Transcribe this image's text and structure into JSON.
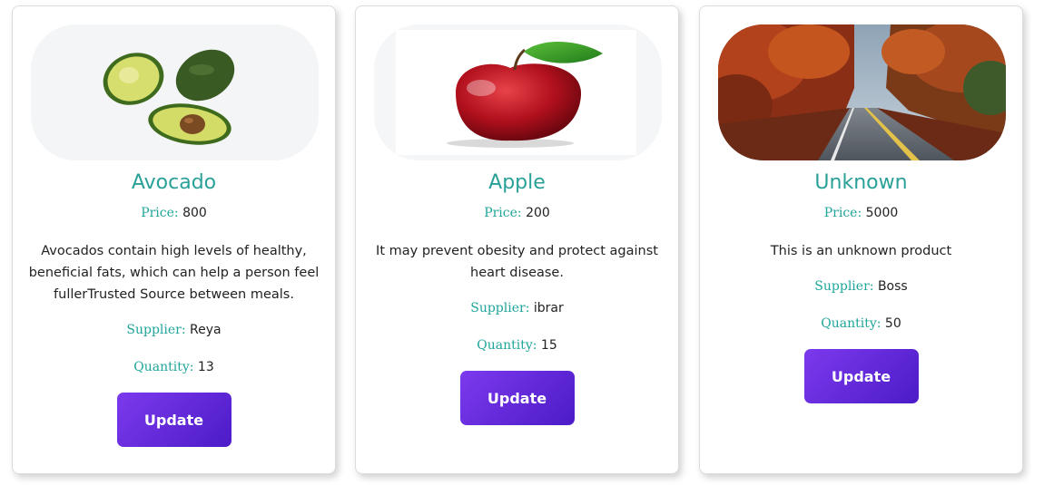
{
  "labels": {
    "price": "Price:",
    "supplier": "Supplier:",
    "quantity": "Quantity:"
  },
  "products": [
    {
      "name": "Avocado",
      "price": "800",
      "description": "Avocados contain high levels of healthy, beneficial fats, which can help a person feel fullerTrusted Source between meals.",
      "supplier": "Reya",
      "quantity": "13",
      "button": "Update",
      "image": "avocado-image"
    },
    {
      "name": "Apple",
      "price": "200",
      "description": "It may prevent obesity and protect against heart disease.",
      "supplier": "ibrar",
      "quantity": "15",
      "button": "Update",
      "image": "apple-image"
    },
    {
      "name": "Unknown",
      "price": "5000",
      "description": "This is an unknown product",
      "supplier": "Boss",
      "quantity": "50",
      "button": "Update",
      "image": "autumn-road-image"
    }
  ],
  "colors": {
    "accent": "#2aa198",
    "button_start": "#7c3aed",
    "button_end": "#4c1bc7"
  }
}
